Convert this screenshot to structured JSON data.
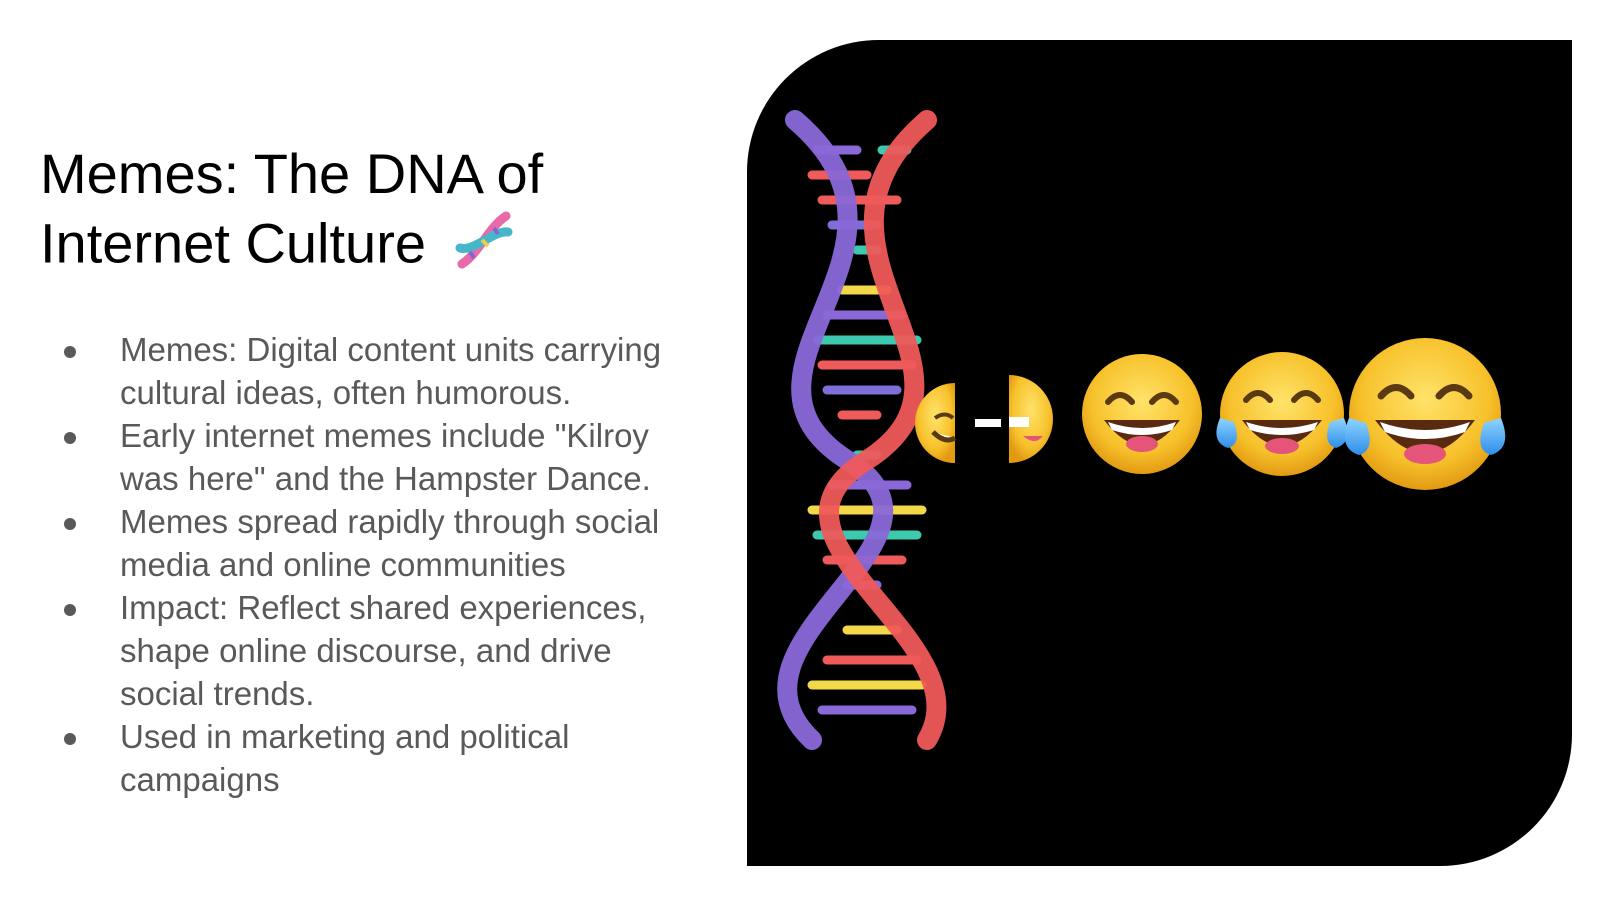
{
  "slide": {
    "title_line1": "Memes: The DNA of",
    "title_line2": "Internet Culture",
    "title_icon": "dna-emoji",
    "bullets": [
      "Memes: Digital content units carrying cultural ideas, often humorous.",
      "Early internet memes include \"Kilroy was here\" and the Hampster Dance.",
      "Memes spread rapidly through social media and online communities",
      "Impact: Reflect shared experiences, shape online discourse, and drive social trends.",
      "Used in marketing and political campaigns"
    ],
    "image": {
      "icons": [
        "dna-helix-icon",
        "sliced-emoji-icon",
        "grinning-emoji-icon",
        "tears-of-joy-emoji-icon",
        "tears-of-joy-emoji-large-icon"
      ]
    }
  },
  "colors": {
    "title": "#000000",
    "body_text": "#595959",
    "panel": "#000000",
    "emoji_yellow": "#F7C12B",
    "strand_red": "#EF5A5A",
    "strand_purple": "#8A68D8"
  }
}
